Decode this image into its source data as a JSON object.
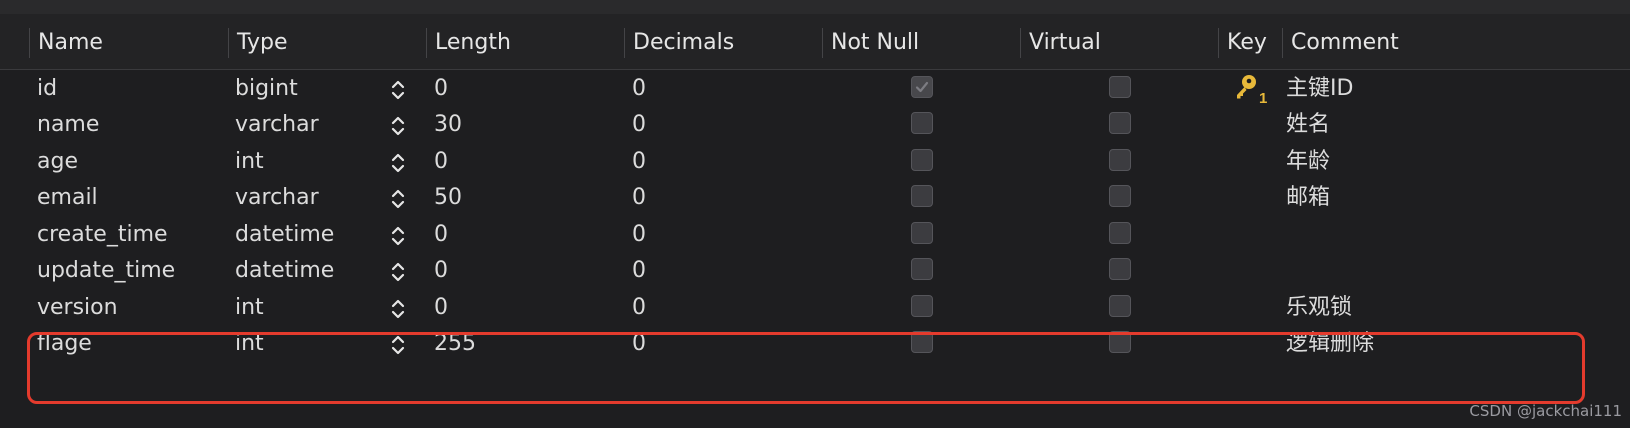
{
  "columns": {
    "name": "Name",
    "type": "Type",
    "length": "Length",
    "decimals": "Decimals",
    "not_null": "Not Null",
    "virtual": "Virtual",
    "key": "Key",
    "comment": "Comment"
  },
  "rows": [
    {
      "name": "id",
      "type": "bigint",
      "length": "0",
      "decimals": "0",
      "not_null": true,
      "virtual": false,
      "key": "1",
      "comment": "主键ID"
    },
    {
      "name": "name",
      "type": "varchar",
      "length": "30",
      "decimals": "0",
      "not_null": false,
      "virtual": false,
      "key": "",
      "comment": "姓名"
    },
    {
      "name": "age",
      "type": "int",
      "length": "0",
      "decimals": "0",
      "not_null": false,
      "virtual": false,
      "key": "",
      "comment": "年龄"
    },
    {
      "name": "email",
      "type": "varchar",
      "length": "50",
      "decimals": "0",
      "not_null": false,
      "virtual": false,
      "key": "",
      "comment": "邮箱"
    },
    {
      "name": "create_time",
      "type": "datetime",
      "length": "0",
      "decimals": "0",
      "not_null": false,
      "virtual": false,
      "key": "",
      "comment": ""
    },
    {
      "name": "update_time",
      "type": "datetime",
      "length": "0",
      "decimals": "0",
      "not_null": false,
      "virtual": false,
      "key": "",
      "comment": ""
    },
    {
      "name": "version",
      "type": "int",
      "length": "0",
      "decimals": "0",
      "not_null": false,
      "virtual": false,
      "key": "",
      "comment": "乐观锁"
    },
    {
      "name": "flage",
      "type": "int",
      "length": "255",
      "decimals": "0",
      "not_null": false,
      "virtual": false,
      "key": "",
      "comment": "逻辑删除"
    }
  ],
  "icons": {
    "type_stepper": "chevron-up-down-icon",
    "primary_key": "key-icon"
  },
  "colors": {
    "background": "#1e1e20",
    "highlight_border": "#e43b2d",
    "key_icon": "#e8b93a"
  },
  "watermark": "CSDN @jackchai111"
}
